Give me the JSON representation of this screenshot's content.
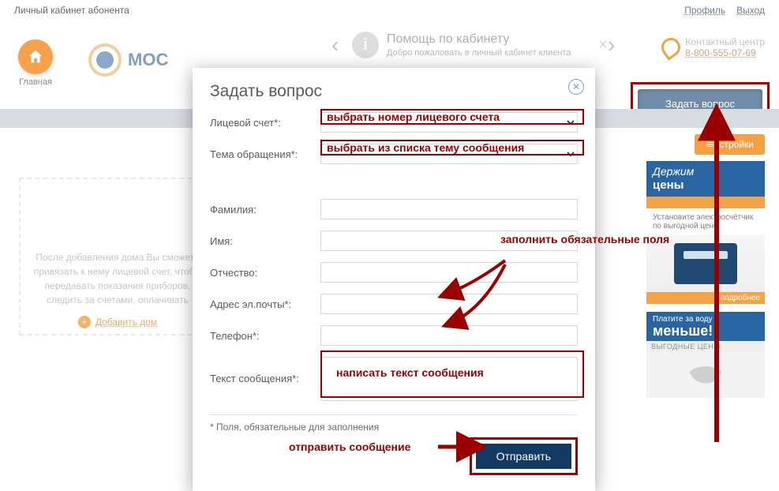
{
  "topbar": {
    "title": "Личный кабинет абонента",
    "profile": "Профиль",
    "logout": "Выход"
  },
  "home_label": "Главная",
  "logo_text": "МОС",
  "banner": {
    "title": "Помощь по кабинету",
    "sub": "Добро пожаловать в личный кабинет клиента"
  },
  "contact": {
    "label": "Контактный центр",
    "phone": "8-800-555-07-69"
  },
  "ask_button": "Задать вопрос",
  "settings_tab": "стройки",
  "dashbox": {
    "text": "После добавления дома Вы сможете привязать к нему лицевой счет, чтобы передавать показания приборов, следить за счетами, оплачивать",
    "add": "Добавить дом"
  },
  "ads": {
    "ad1": {
      "l1": "Держим",
      "l2": "цены",
      "body": "Установите электросчётчик по выгодной цене",
      "more": "подробнее"
    },
    "ad2": {
      "top": "Платите за воду",
      "big": "меньше!",
      "sub": "ВЫГОДНЫЕ ЦЕНЫ"
    }
  },
  "modal": {
    "title": "Задать вопрос",
    "account": "Лицевой счет*:",
    "topic": "Тема обращения*:",
    "lastname": "Фамилия:",
    "firstname": "Имя:",
    "middlename": "Отчество:",
    "email": "Адрес эл.почты*:",
    "phone": "Телефон*:",
    "message": "Текст сообщения*:",
    "reqnote": "* Поля, обязательные для заполнения",
    "submit": "Отправить"
  },
  "annotations": {
    "a1": "выбрать номер лицевого счета",
    "a2": "выбрать из списка тему сообщения",
    "a3": "заполнить обязательные поля",
    "a4": "написать текст сообщения",
    "a5": "отправить сообщение"
  }
}
